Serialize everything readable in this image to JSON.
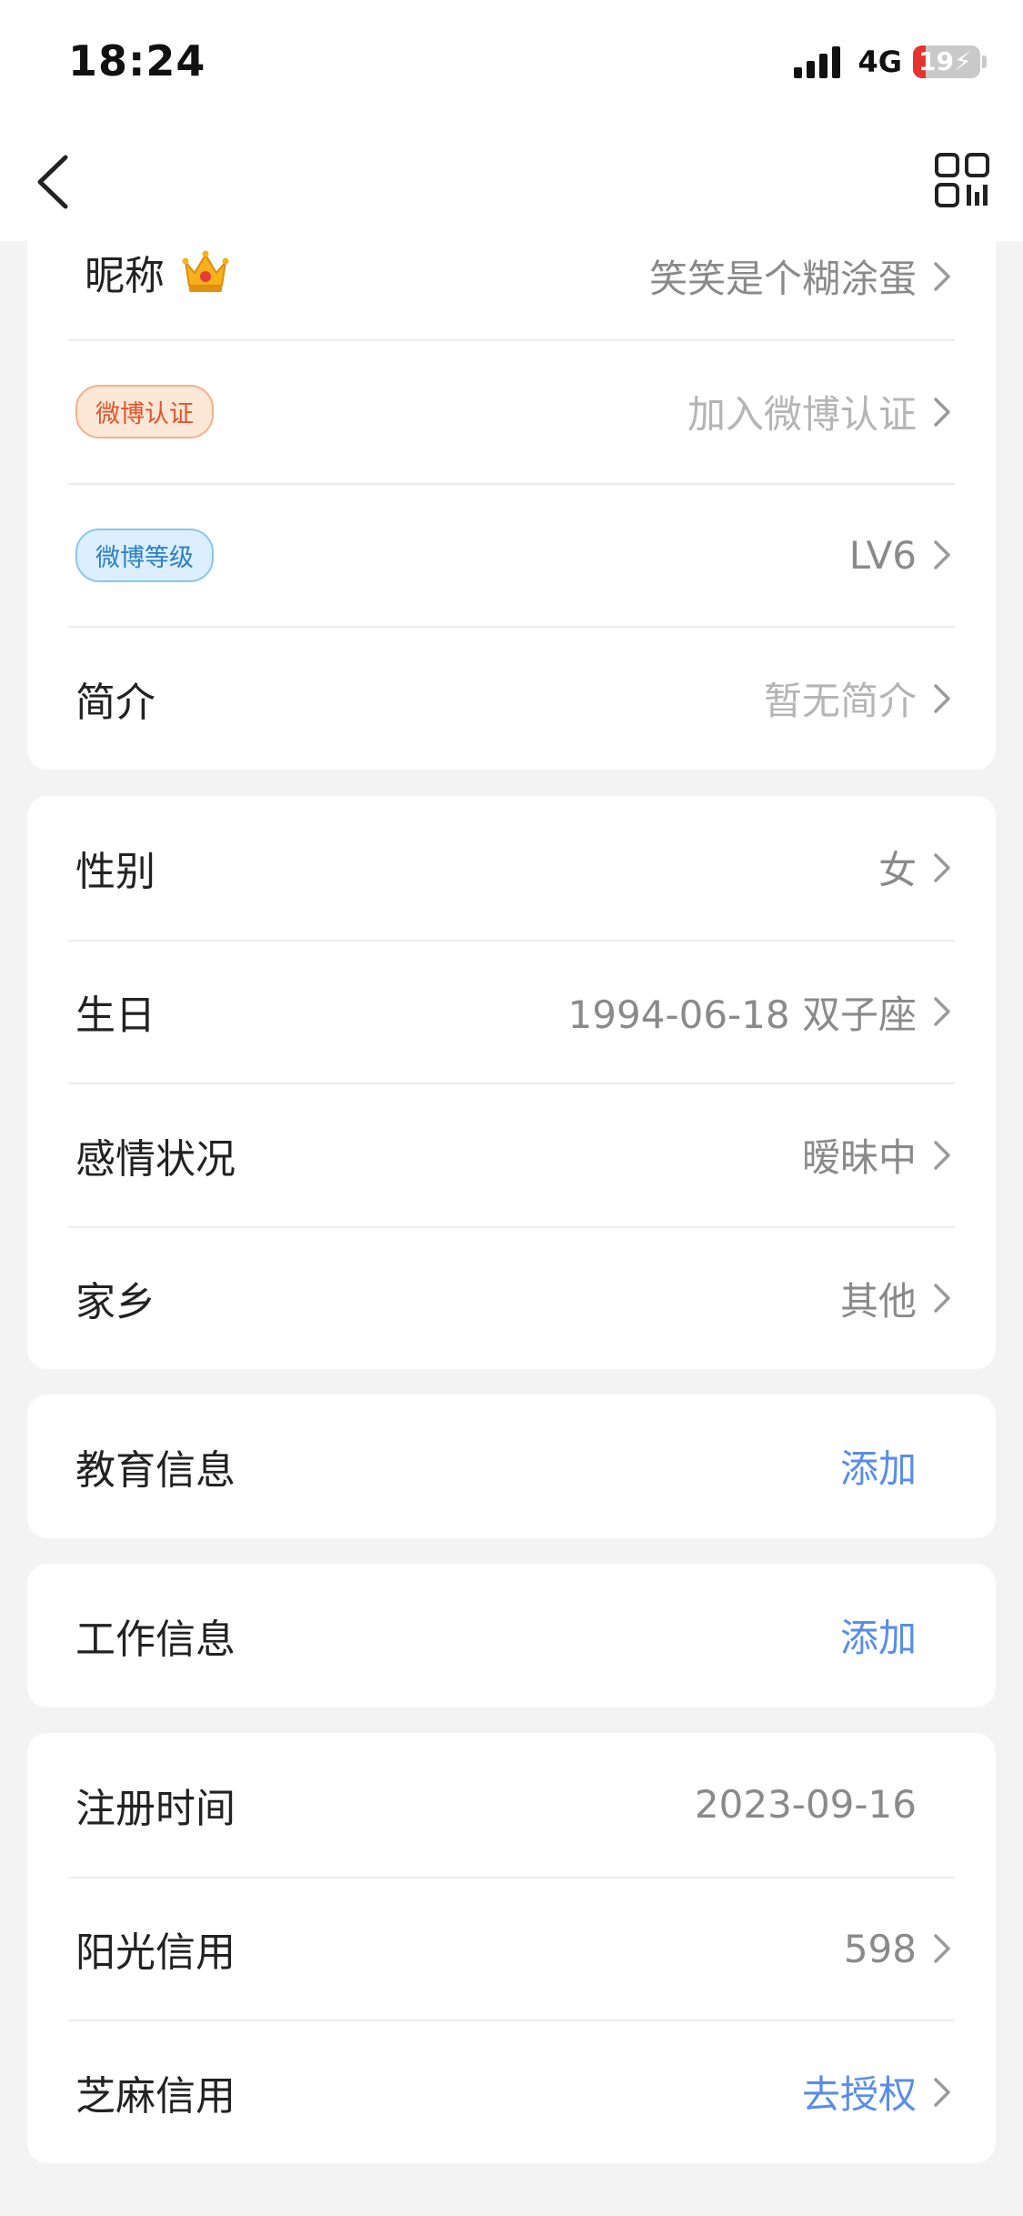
{
  "status": {
    "time": "18:24",
    "network": "4G",
    "battery_level": 19,
    "battery_text": "19"
  },
  "profile": {
    "nickname_label": "昵称",
    "nickname_value": "笑笑是个糊涂蛋",
    "verify_badge": "微博认证",
    "verify_value": "加入微博认证",
    "level_badge": "微博等级",
    "level_value": "LV6",
    "bio_label": "简介",
    "bio_value": "暂无简介"
  },
  "personal": {
    "gender_label": "性别",
    "gender_value": "女",
    "birthday_label": "生日",
    "birthday_value": "1994-06-18 双子座",
    "relationship_label": "感情状况",
    "relationship_value": "暧昧中",
    "hometown_label": "家乡",
    "hometown_value": "其他"
  },
  "education": {
    "label": "教育信息",
    "action": "添加"
  },
  "work": {
    "label": "工作信息",
    "action": "添加"
  },
  "account": {
    "register_label": "注册时间",
    "register_value": "2023-09-16",
    "sunshine_label": "阳光信用",
    "sunshine_value": "598",
    "sesame_label": "芝麻信用",
    "sesame_value": "去授权"
  },
  "colors": {
    "link": "#5a8de6",
    "verify_badge": "#e1552c",
    "level_badge": "#2b7fc6",
    "battery_low": "#e5332f"
  },
  "icons": [
    "chevron-left-icon",
    "qr-code-icon",
    "crown-icon",
    "chevron-right-icon"
  ]
}
